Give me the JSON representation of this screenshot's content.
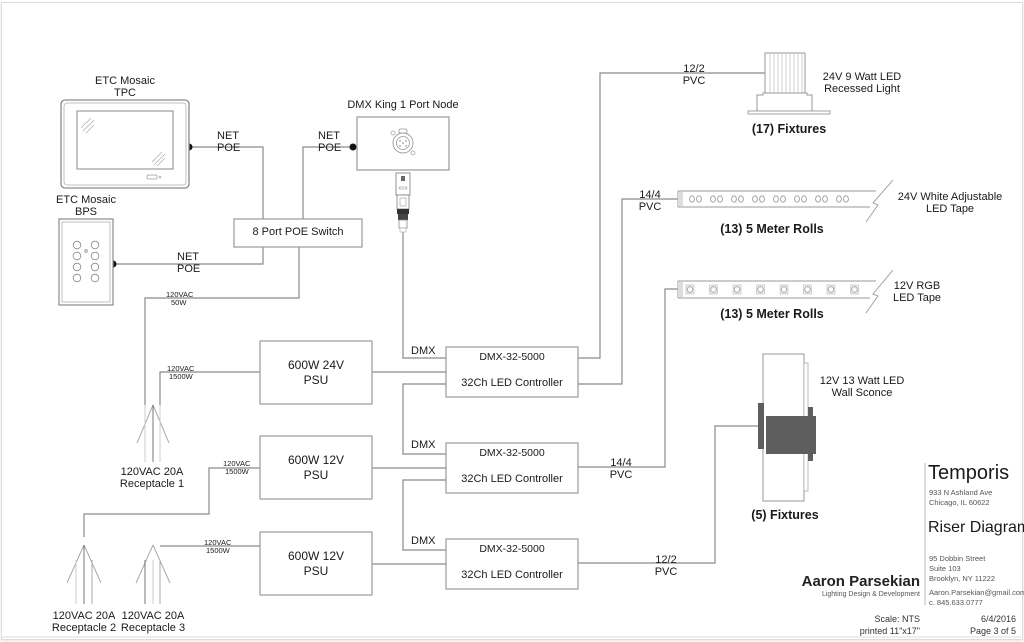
{
  "devices": {
    "tpc": {
      "label_line1": "ETC Mosaic",
      "label_line2": "TPC"
    },
    "bps": {
      "label_line1": "ETC Mosaic",
      "label_line2": "BPS"
    },
    "node": {
      "label": "DMX King 1 Port Node"
    },
    "switch": {
      "label": "8 Port POE Switch"
    },
    "psu1": {
      "line1": "600W 24V",
      "line2": "PSU"
    },
    "psu2": {
      "line1": "600W 12V",
      "line2": "PSU"
    },
    "psu3": {
      "line1": "600W 12V",
      "line2": "PSU"
    },
    "ctrl1": {
      "model": "DMX-32-5000",
      "desc": "32Ch LED Controller"
    },
    "ctrl2": {
      "model": "DMX-32-5000",
      "desc": "32Ch LED Controller"
    },
    "ctrl3": {
      "model": "DMX-32-5000",
      "desc": "32Ch LED Controller"
    }
  },
  "wire_labels": {
    "tpc_net": {
      "line1": "NET",
      "line2": "POE"
    },
    "node_net": {
      "line1": "NET",
      "line2": "POE"
    },
    "bps_net": {
      "line1": "NET",
      "line2": "POE"
    },
    "switch_power": {
      "line1": "120VAC",
      "line2": "50W"
    },
    "psu1_power": {
      "line1": "120VAC",
      "line2": "1500W"
    },
    "psu2_power": {
      "line1": "120VAC",
      "line2": "1500W"
    },
    "psu3_power": {
      "line1": "120VAC",
      "line2": "1500W"
    },
    "dmx1": "DMX",
    "dmx2": "DMX",
    "dmx3": "DMX",
    "recessed_cable": {
      "line1": "12/2",
      "line2": "PVC"
    },
    "tape24_cable": {
      "line1": "14/4",
      "line2": "PVC"
    },
    "sconce14_cable": {
      "line1": "14/4",
      "line2": "PVC"
    },
    "sconce12_cable": {
      "line1": "12/2",
      "line2": "PVC"
    }
  },
  "receptacles": [
    {
      "line1": "120VAC 20A",
      "line2": "Receptacle 1"
    },
    {
      "line1": "120VAC 20A",
      "line2": "Receptacle 2"
    },
    {
      "line1": "120VAC 20A",
      "line2": "Receptacle 3"
    }
  ],
  "fixtures": {
    "recessed": {
      "desc_line1": "24V 9 Watt LED",
      "desc_line2": "Recessed Light",
      "qty": "(17) Fixtures"
    },
    "tape_white": {
      "desc_line1": "24V White Adjustable",
      "desc_line2": "LED Tape",
      "qty": "(13) 5 Meter Rolls"
    },
    "tape_rgb": {
      "desc_line1": "12V RGB",
      "desc_line2": "LED Tape",
      "qty": "(13) 5 Meter Rolls"
    },
    "sconce": {
      "desc_line1": "12V 13 Watt LED",
      "desc_line2": "Wall Sconce",
      "qty": "(5) Fixtures"
    }
  },
  "title_block": {
    "client": "Temporis",
    "client_address_line1": "933 N Ashland Ave",
    "client_address_line2": "Chicago, IL 60622",
    "drawing_title": "Riser Diagram",
    "designer_address_line1": "95 Dobbin Street",
    "designer_address_line2": "Suite 103",
    "designer_address_line3": "Brooklyn, NY 11222",
    "designer_email": "Aaron.Parsekian@gmail.com",
    "designer_phone": "c. 845.633.0777",
    "designer_name": "Aaron Parsekian",
    "designer_tagline": "Lighting Design & Development",
    "scale": "Scale: NTS",
    "printed": "printed 11\"x17\"",
    "date": "6/4/2016",
    "page": "Page 3 of 5"
  },
  "colors": {
    "wire": "#8a8a8a",
    "fixture_dark": "#5e5e5e",
    "text": "#1a1a1a"
  }
}
